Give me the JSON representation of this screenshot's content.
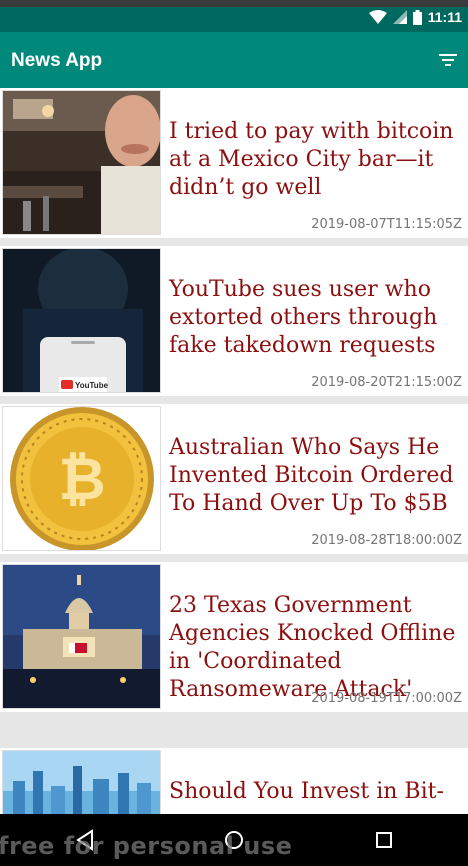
{
  "status_bar": {
    "time": "11:11",
    "icons": [
      "wifi-icon",
      "signal-icon",
      "battery-icon"
    ]
  },
  "app_bar": {
    "title": "News App",
    "filter_icon": "filter-icon"
  },
  "articles": [
    {
      "headline": "I tried to pay with bitcoin at a Mexico City bar—it didn’t go well",
      "date": "2019-08-07T11:15:05Z",
      "image": "bar-photo"
    },
    {
      "headline": "YouTube sues user who extorted others through fake takedown requests",
      "date": "2019-08-20T21:15:00Z",
      "image": "hacker-phone-photo"
    },
    {
      "headline": "Australian Who Says He Invented Bitcoin Ordered To Hand Over Up To $5B",
      "date": "2019-08-28T18:00:00Z",
      "image": "bitcoin-coin"
    },
    {
      "headline": "23 Texas Government Agencies Knocked Offline in 'Coordinated Ransomeware Attack'",
      "date": "2019-08-19T17:00:00Z",
      "image": "capitol-photo"
    },
    {
      "headline": "Should You Invest in Bit-",
      "date": "",
      "image": "blue-city-photo"
    }
  ],
  "thumb_labels": {
    "youtube": "YouTube"
  },
  "nav": {
    "back": "back-icon",
    "home": "home-icon",
    "recents": "recents-icon"
  },
  "watermark": "free for personal use",
  "colors": {
    "app_bar": "#00897b",
    "status_bar": "#00695f",
    "headline": "#8b0f0f",
    "date": "#757575"
  }
}
